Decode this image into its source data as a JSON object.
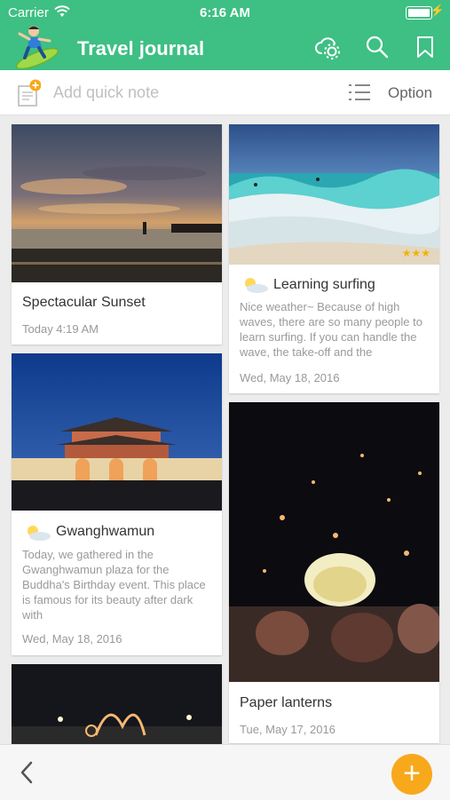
{
  "status_bar": {
    "carrier": "Carrier",
    "time": "6:16 AM"
  },
  "app": {
    "title": "Travel journal"
  },
  "header_icons": [
    "cloud-gear-icon",
    "search-icon",
    "bookmark-icon"
  ],
  "quick_note": {
    "placeholder": "Add quick note",
    "option_label": "Option"
  },
  "entries": [
    {
      "title": "Spectacular Sunset",
      "date": "Today 4:19 AM"
    },
    {
      "title": "Learning surfing",
      "weather": "partly-cloudy-icon",
      "body": "Nice weather~ Because of high waves, there are so many people to learn surfing. If you can handle the wave, the take-off and the",
      "date": "Wed, May 18, 2016",
      "rating": 3,
      "rating_display": "★★★"
    },
    {
      "title": "Gwanghwamun",
      "weather": "partly-cloudy-icon",
      "body": "Today, we gathered in the Gwanghwamun plaza for the Buddha's Birthday event. This place is famous for its beauty after dark with",
      "date": "Wed, May 18, 2016"
    },
    {
      "title": "Paper lanterns",
      "date": "Tue, May 17, 2016"
    },
    {
      "title": "",
      "date": ""
    }
  ],
  "bottom": {
    "add_label": "+"
  },
  "colors": {
    "header": "#3ebf84",
    "fab": "#f8a81b",
    "stars": "#f0b400"
  }
}
